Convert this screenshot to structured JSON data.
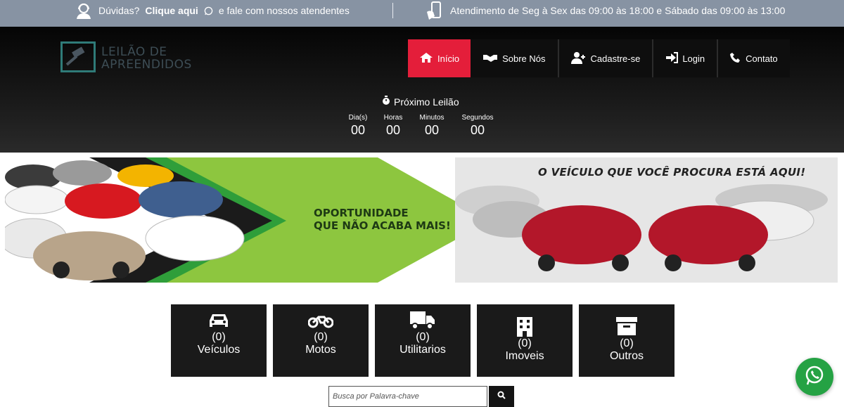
{
  "topbar": {
    "help_prefix": "Dúvidas?",
    "help_link": "Clique aqui",
    "help_suffix": "e fale com nossos atendentes",
    "hours": "Atendimento de Seg à Sex das 09:00 às 18:00 e Sábado das 09:00 às 13:00",
    "icons": [
      "support-agent-icon",
      "whatsapp-icon",
      "phone-hand-icon"
    ]
  },
  "logo": {
    "line1": "LEILÃO DE",
    "line2": "APREENDIDOS",
    "icon": "gavel-icon"
  },
  "nav": {
    "items": [
      {
        "label": "Início",
        "icon": "home-icon",
        "active": true
      },
      {
        "label": "Sobre Nós",
        "icon": "handshake-icon",
        "active": false
      },
      {
        "label": "Cadastre-se",
        "icon": "user-plus-icon",
        "active": false
      },
      {
        "label": "Login",
        "icon": "sign-in-icon",
        "active": false
      },
      {
        "label": "Contato",
        "icon": "phone-icon",
        "active": false
      }
    ],
    "active_color": "#e41e3a"
  },
  "countdown": {
    "title": "Próximo Leilão",
    "icon": "stopwatch-icon",
    "cells": [
      {
        "label": "Dia(s)",
        "value": "00"
      },
      {
        "label": "Horas",
        "value": "00"
      },
      {
        "label": "Minutos",
        "value": "00"
      },
      {
        "label": "Segundos",
        "value": "00"
      }
    ]
  },
  "banner": {
    "left_text_1": "OPORTUNIDADE",
    "left_text_2": "QUE NÃO ACABA MAIS!",
    "headline": "O VEÍCULO QUE VOCÊ PROCURA ESTÁ AQUI!",
    "accent_color": "#8dc63f"
  },
  "categories": [
    {
      "count": "(0)",
      "name": "Veículos",
      "icon": "car-icon"
    },
    {
      "count": "(0)",
      "name": "Motos",
      "icon": "motorcycle-icon"
    },
    {
      "count": "(0)",
      "name": "Utilitarios",
      "icon": "truck-icon"
    },
    {
      "count": "(0)",
      "name": "Imoveis",
      "icon": "building-icon"
    },
    {
      "count": "(0)",
      "name": "Outros",
      "icon": "archive-icon"
    }
  ],
  "search": {
    "placeholder": "Busca por Palavra-chave",
    "value": "",
    "icon": "search-icon"
  },
  "floating": {
    "icon": "whatsapp-icon",
    "color": "#25a244"
  }
}
